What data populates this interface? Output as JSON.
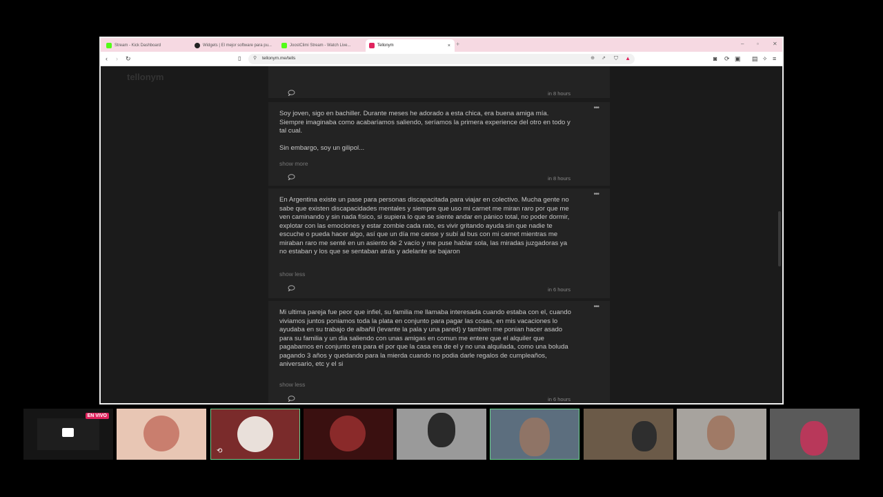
{
  "browser": {
    "tabs": [
      {
        "title": "Stream - Kick Dashboard",
        "color": "#53fc18"
      },
      {
        "title": "Widgets | El mejor software para pu...",
        "color": "#222222"
      },
      {
        "title": "JoostClimi Stream - Watch Live...",
        "color": "#53fc18"
      },
      {
        "title": "Tellonym",
        "color": "#e0245e"
      }
    ],
    "close_tab": "×",
    "new_tab": "+",
    "url": "tellonym.me/tells"
  },
  "site": {
    "logo": "tellonym",
    "accent": "#3db8a5",
    "notification_color": "#e0245e"
  },
  "tells": [
    {
      "text": "",
      "more": "",
      "time": "in 8 hours"
    },
    {
      "text": "Soy joven, sigo en bachiller. Durante meses he adorado a esta chica, era buena amiga mía. Siempre imaginaba como acabaríamos saliendo, seríamos la primera experience del otro en todo y tal cual.\n\nSin embargo, soy un gilipol...",
      "more": "show more",
      "time": "in 8 hours"
    },
    {
      "text": "En Argentina existe un pase para personas discapacitada para viajar en colectivo. Mucha gente no sabe que existen discapacidades mentales y siempre que uso mi carnet me miran raro por que me ven caminando y sin nada físico, si supiera lo que se siente andar en pánico total, no poder dormir, explotar con las emociones y estar zombie cada rato, es vivir gritando ayuda sin que nadie te escuche o pueda hacer algo, así que un día me canse y subí al bus con mi carnet mientras me miraban raro me senté en un asiento de 2 vacío y me puse hablar sola, las miradas juzgadoras ya no estaban y los que se sentaban atrás y adelante se bajaron",
      "more": "show less",
      "time": "in 6 hours"
    },
    {
      "text": "Mi ultima pareja fue peor que infiel, su familia me llamaba interesada cuando estaba con el, cuando viviamos juntos poniamos toda la plata en conjunto para pagar las cosas, en mis vacaciones lo ayudaba en su trabajo de albañil (levante la pala y una pared) y tambien me ponian hacer asado para su familia y un dia saliendo con unas amigas en comun me entere que el alquiler que pagabamos en conjunto era para el por que la casa era de el y no una alquilada, como una boluda pagando 3 años y quedando para la mierda cuando no podia darle regalos de cumpleaños, aniversario, etc y el si",
      "more": "show less",
      "time": "in 6 hours"
    }
  ],
  "stream_strip": {
    "live_badge": "EN VIVO",
    "accent": "#6bd38f"
  }
}
